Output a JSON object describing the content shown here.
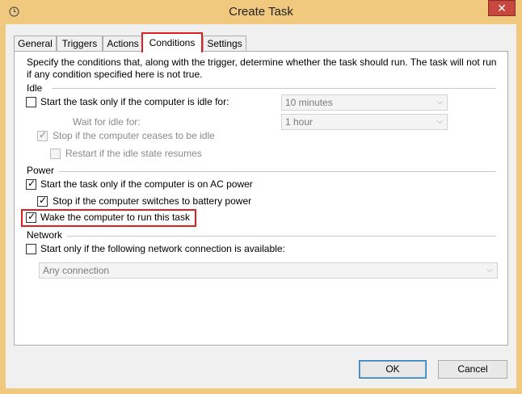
{
  "window": {
    "title": "Create Task"
  },
  "tabs": [
    {
      "label": "General"
    },
    {
      "label": "Triggers"
    },
    {
      "label": "Actions"
    },
    {
      "label": "Conditions"
    },
    {
      "label": "Settings"
    }
  ],
  "description": "Specify the conditions that, along with the trigger, determine whether the task should run.  The task will not run  if any condition specified here is not true.",
  "idle": {
    "heading": "Idle",
    "start_if_idle": {
      "label": "Start the task only if the computer is idle for:",
      "checked": false
    },
    "idle_for_value": "10 minutes",
    "wait_label": "Wait for idle for:",
    "wait_value": "1 hour",
    "stop_if_ceases": {
      "label": "Stop if the computer ceases to be idle",
      "checked": true,
      "enabled": false
    },
    "restart_if_resumes": {
      "label": "Restart if the idle state resumes",
      "checked": false,
      "enabled": false
    }
  },
  "power": {
    "heading": "Power",
    "ac_power": {
      "label": "Start the task only if the computer is on AC power",
      "checked": true
    },
    "battery_stop": {
      "label": "Stop if the computer switches to battery power",
      "checked": true
    },
    "wake": {
      "label": "Wake the computer to run this task",
      "checked": true
    }
  },
  "network": {
    "heading": "Network",
    "connection_check": {
      "label": "Start only if the following network connection is available:",
      "checked": false
    },
    "connection_value": "Any connection"
  },
  "buttons": {
    "ok": "OK",
    "cancel": "Cancel"
  },
  "colors": {
    "titlebar": "#f0c87e",
    "highlight": "#e02020",
    "close": "#c7463d"
  }
}
